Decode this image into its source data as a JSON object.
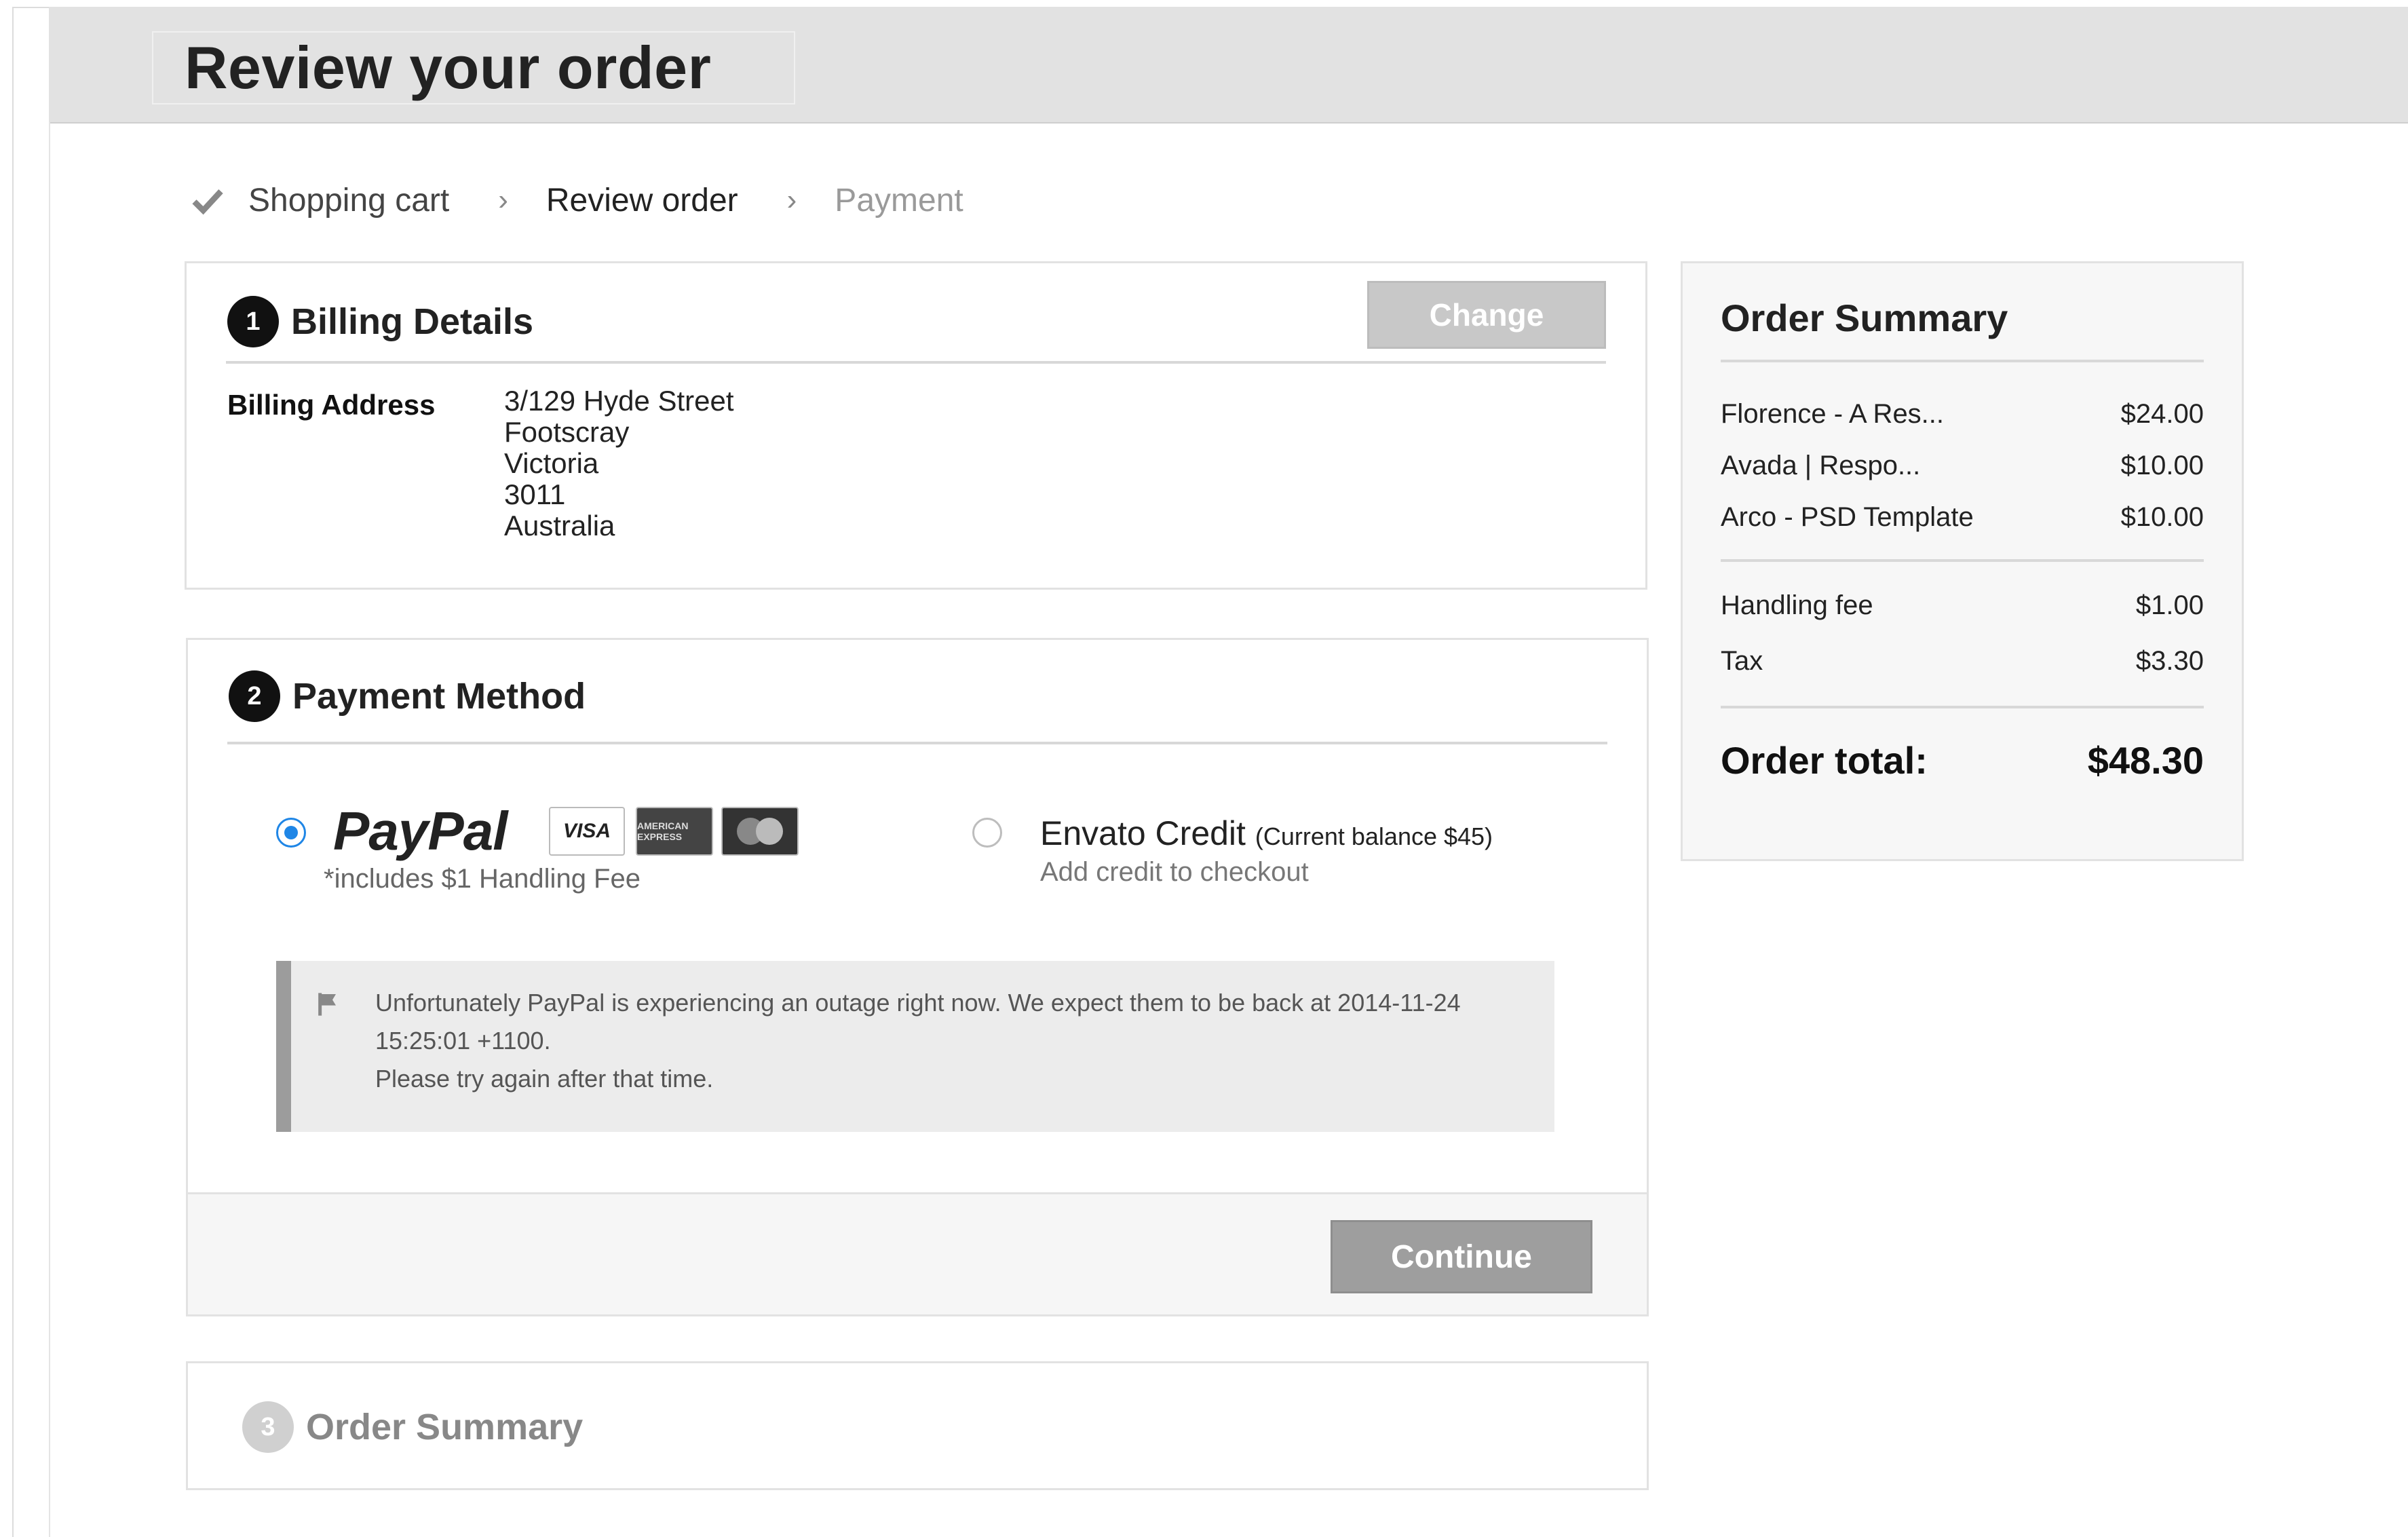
{
  "page": {
    "title": "Review your order"
  },
  "steps": [
    {
      "label": "Shopping cart",
      "state": "done"
    },
    {
      "label": "Review order",
      "state": "current"
    },
    {
      "label": "Payment",
      "state": "upcoming"
    }
  ],
  "billing": {
    "number": "1",
    "title": "Billing Details",
    "change_label": "Change",
    "address_label": "Billing Address",
    "address_lines": [
      "3/129 Hyde Street",
      "Footscray",
      "Victoria",
      "3011",
      "Australia"
    ]
  },
  "payment": {
    "number": "2",
    "title": "Payment Method",
    "paypal": {
      "brand": "PayPal",
      "note": "*includes $1 Handling Fee",
      "selected": true,
      "cards": [
        "VISA",
        "AMERICAN EXPRESS",
        "MasterCard"
      ]
    },
    "envato": {
      "title": "Envato Credit",
      "balance": "(Current balance $45)",
      "sub": "Add credit to checkout",
      "selected": false
    },
    "alert": {
      "line1": "Unfortunately PayPal is experiencing an outage right now. We expect them to be back at 2014-11-24 15:25:01 +1100.",
      "line2": "Please try again after that time."
    },
    "continue_label": "Continue"
  },
  "order_summary_step": {
    "number": "3",
    "title": "Order Summary"
  },
  "sidebar": {
    "title": "Order Summary",
    "items": [
      {
        "name": "Florence - A Res...",
        "price": "$24.00"
      },
      {
        "name": "Avada | Respo...",
        "price": "$10.00"
      },
      {
        "name": "Arco - PSD Template",
        "price": "$10.00"
      }
    ],
    "fees": [
      {
        "name": "Handling fee",
        "price": "$1.00"
      },
      {
        "name": "Tax",
        "price": "$3.30"
      }
    ],
    "total_label": "Order total:",
    "total_value": "$48.30"
  },
  "colors": {
    "radio_selected": "#1f86e6",
    "header_bg": "#e2e2e2",
    "button_disabled": "#c8c8c8",
    "button_primary": "#9e9e9e"
  },
  "icons": [
    "check-icon",
    "chevron-right-icon",
    "flag-icon",
    "radio-selected-icon",
    "radio-empty-icon"
  ]
}
